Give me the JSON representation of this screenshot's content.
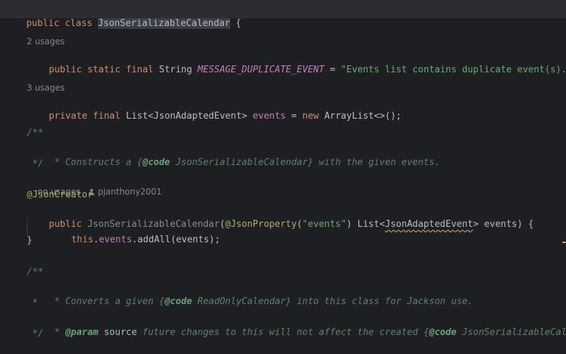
{
  "code": {
    "l1": {
      "kw1": "public",
      "kw2": "class",
      "name": "JsonSerializableCalendar",
      "brace": " {"
    },
    "hint_duplicate": "2 usages",
    "l2": {
      "kw1": "public",
      "kw2": "static",
      "kw3": "final",
      "type": "String",
      "name": "MESSAGE_DUPLICATE_EVENT",
      "eq": " = ",
      "value": "\"Events list contains duplicate event(s).\"",
      "end": ";"
    },
    "hint_events": "3 usages",
    "l3": {
      "kw1": "private",
      "kw2": "final",
      "type": "List<JsonAdaptedEvent>",
      "name": "events",
      "eq": " = ",
      "kw3": "new",
      "rest": "ArrayList<>();"
    },
    "doc1": {
      "open": "/**",
      "line_prefix": " * Constructs a ",
      "line_brace_open": "{",
      "line_tag": "@code",
      "line_ref": " JsonSerializableCalendar}",
      "line_suffix": " with the given events.",
      "close": " */"
    },
    "hint_ctor": {
      "usages": "no usages",
      "author": "pjanthony2001"
    },
    "annotation": "@JsonCreator",
    "ctor": {
      "kw": "public",
      "name": "JsonSerializableCalendar",
      "p_open": "(",
      "param_ann": "@JsonProperty",
      "param_ann_open": "(",
      "param_str": "\"events\"",
      "param_ann_close": ") ",
      "param_type_a": "List<",
      "param_type_b": "JsonAdaptedEvent",
      "param_type_c": "> events) {"
    },
    "body": {
      "this": "this",
      "dot": ".",
      "field": "events",
      "call": ".addAll(events);"
    },
    "close_brace": "}",
    "doc2": {
      "open": "/**",
      "l1_prefix": " * Converts a given ",
      "l1_brace": "{",
      "l1_tag": "@code",
      "l1_ref": " ReadOnlyCalendar}",
      "l1_suffix": " into this class for Jackson use.",
      "l2": " *",
      "l3_prefix": " * ",
      "l3_tag": "@param",
      "l3_param": " source",
      "l3_text": " future changes to this will not affect the created ",
      "l3_brace": "{",
      "l3_tag2": "@code",
      "l3_ref": " JsonSerializableCalen",
      "close": " */"
    }
  },
  "colors": {
    "background": "#1e1f22",
    "keyword": "#cf8e6d",
    "string": "#6aab73",
    "constant": "#c77dbb",
    "doc": "#5f826b",
    "annotation": "#b3ae60",
    "method": "#56a8f5",
    "hint": "#868991"
  }
}
